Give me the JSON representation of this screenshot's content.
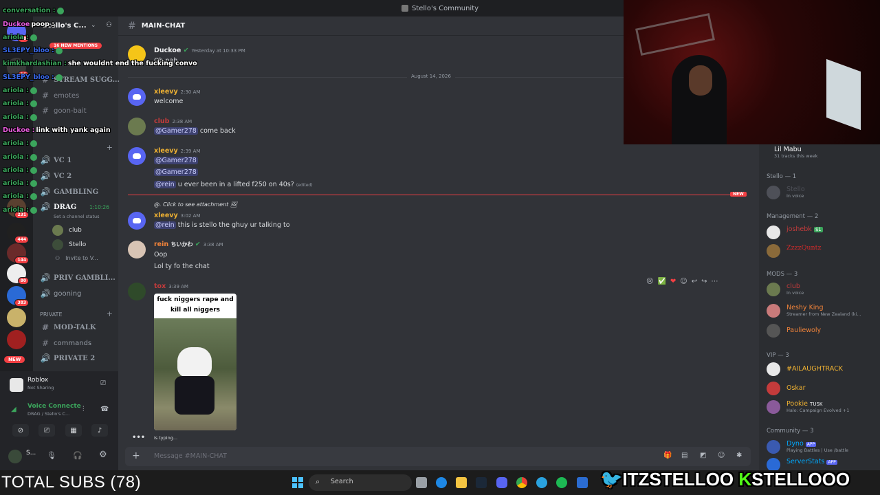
{
  "titlebar": {
    "title": "Stello's Community"
  },
  "server_rail": {
    "badges": [
      "48",
      "16",
      "231",
      "444",
      "144",
      "80",
      "383"
    ],
    "new_label": "NEW",
    "new_mentions": "16 NEW MENTIONS"
  },
  "sidebar": {
    "server_name": "Stello's C...",
    "channels": {
      "stream_sugg": "STREAM SUGG...",
      "emotes": "emotes",
      "goon_bait": "goon-bait",
      "vc1": "VC 1",
      "vc2": "VC 2",
      "gambling": "GAMBLING",
      "drag": "DRAG",
      "drag_time": "1:10:26",
      "drag_status": "Set a channel status",
      "voice_users": [
        "club",
        "Stello"
      ],
      "invite": "Invite to V...",
      "priv_gambling": "PRIV GAMBLI...",
      "gooning": "gooning",
      "private_cat": "PRIVATE",
      "mod_talk": "MOD-TALK",
      "commands": "commands",
      "private2": "PRIVATE 2"
    }
  },
  "voice_panel": {
    "activity": "Roblox",
    "activity_sub": "Not Sharing",
    "connected": "Voice Connecte",
    "connected_sub": "DRAG / Stello's C...",
    "user": "S..."
  },
  "chat": {
    "channel": "MAIN-CHAT",
    "date_divider": "August 14, 2026",
    "new_label": "NEW",
    "messages": [
      {
        "author": "Duckoe",
        "time": "Yesterday at 10:33 PM",
        "text": "Oh nah"
      },
      {
        "author": "xleevy",
        "time": "2:30 AM",
        "text": "welcome"
      },
      {
        "author": "club",
        "time": "2:38 AM",
        "mention": "@Gamer278",
        "text": "come back"
      },
      {
        "author": "xleevy",
        "time": "2:39 AM",
        "mention1": "@Gamer278",
        "mention2": "@Gamer278",
        "mention3": "@rein",
        "text": "u ever been in a lifted f250 on 40s?",
        "edited": "(edited)"
      },
      {
        "reply": "@. Click to see attachment",
        "author": "xleevy",
        "time": "3:02 AM",
        "mention": "@rein",
        "text": "this is stello the ghuy ur talking to"
      },
      {
        "author": "rein",
        "tag": "ちいかわ",
        "time": "3:38 AM",
        "line1": "Oop",
        "line2": "Lol ty fo the chat"
      },
      {
        "author": "tox",
        "time": "3:39 AM",
        "image_caption": "fuck niggers rape and kill all niggers"
      }
    ],
    "typing": "is typing...",
    "composer_placeholder": "Message #MAIN-CHAT"
  },
  "members": {
    "top": {
      "name": "Lil Mabu",
      "status": "31 tracks this week"
    },
    "groups": [
      {
        "header": "Stello — 1",
        "members": [
          {
            "name": "Stello",
            "status": "In voice",
            "color": "#4e5058"
          }
        ]
      },
      {
        "header": "Management — 2",
        "members": [
          {
            "name": "joshebk",
            "status": "",
            "badge": "$1",
            "color": "#c43b3b"
          },
          {
            "name": "ZzzzQuntz",
            "status": "",
            "color": "#d12a2a"
          }
        ]
      },
      {
        "header": "MODS — 3",
        "members": [
          {
            "name": "club",
            "status": "In voice",
            "color": "#c43b3b"
          },
          {
            "name": "Neshy King",
            "status": "Streamer from New Zealand (ki...",
            "color": "#f0833a"
          },
          {
            "name": "Pauliewoly",
            "status": "",
            "color": "#f0833a"
          }
        ]
      },
      {
        "header": "VIP — 3",
        "members": [
          {
            "name": "#AILAUGHTRACK",
            "status": "",
            "color": "#f0b232"
          },
          {
            "name": "Oskar",
            "status": "",
            "color": "#f0b232"
          },
          {
            "name": "Pookie",
            "tag": "TUSK",
            "status": "Halo: Campaign Evolved +1",
            "color": "#f0b232"
          }
        ]
      },
      {
        "header": "Community — 3",
        "members": [
          {
            "name": "Dyno",
            "app": "APP",
            "status": "Playing Battles | Use /battle",
            "color": "#00a8fc"
          },
          {
            "name": "ServerStats",
            "app": "APP",
            "status": "",
            "color": "#00a8fc"
          }
        ]
      }
    ]
  },
  "overlay_chat": [
    {
      "user": "conversation :",
      "color": "#3ba55c",
      "text": ""
    },
    {
      "user": "Duckoe",
      "color": "#e85dde",
      "text": "poop :"
    },
    {
      "user": "ariola :",
      "color": "#3ba55c",
      "text": ""
    },
    {
      "user": "SL3EPY_bloo :",
      "color": "#3b6bf0",
      "text": ""
    },
    {
      "user": "kimkhardashian :",
      "color": "#3ba55c",
      "text": "she wouldnt end the fucking convo"
    },
    {
      "user": "SL3EPY_bloo :",
      "color": "#3b6bf0",
      "text": ""
    },
    {
      "user": "ariola :",
      "color": "#3ba55c",
      "text": ""
    },
    {
      "user": "ariola :",
      "color": "#3ba55c",
      "text": ""
    },
    {
      "user": "ariola :",
      "color": "#3ba55c",
      "text": ""
    },
    {
      "user": "Duckoe :",
      "color": "#e85dde",
      "text": "link with yank again"
    },
    {
      "user": "ariola :",
      "color": "#3ba55c",
      "text": ""
    },
    {
      "user": "ariola :",
      "color": "#3ba55c",
      "text": ""
    },
    {
      "user": "ariola :",
      "color": "#3ba55c",
      "text": ""
    },
    {
      "user": "ariola :",
      "color": "#3ba55c",
      "text": ""
    },
    {
      "user": "ariola :",
      "color": "#3ba55c",
      "text": ""
    },
    {
      "user": "ariola :",
      "color": "#3ba55c",
      "text": ""
    }
  ],
  "taskbar": {
    "subs": "TOTAL SUBS (78)",
    "search": "Search"
  },
  "socials": {
    "twitter": "ITZSTELLOO",
    "kick": "STELLOOO"
  }
}
